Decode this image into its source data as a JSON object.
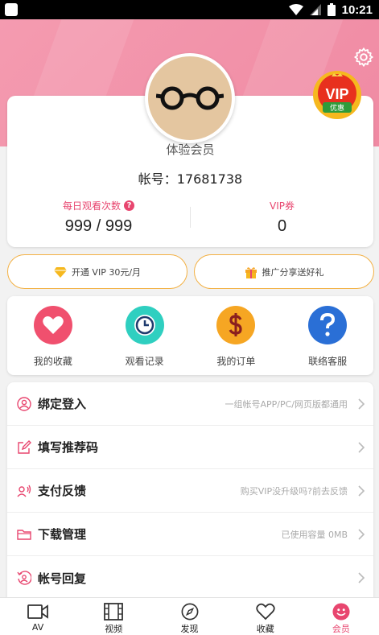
{
  "status_bar": {
    "time": "10:21"
  },
  "profile": {
    "member_name": "体验会员",
    "account": "帐号：17681738",
    "vip_badge_text": "VIP",
    "vip_badge_sub": "优惠",
    "stats": [
      {
        "label": "每日观看次数",
        "value": "999 / 999"
      },
      {
        "label": "VIP券",
        "value": "0"
      }
    ]
  },
  "pills": [
    {
      "label": "开通 VIP 30元/月",
      "icon": "diamond-icon"
    },
    {
      "label": "推广分享送好礼",
      "icon": "gift-icon"
    }
  ],
  "quick_actions": [
    {
      "label": "我的收藏",
      "icon": "heart-icon",
      "color": "#f0506e"
    },
    {
      "label": "观看记录",
      "icon": "clock-icon",
      "color": "#2fcfc0"
    },
    {
      "label": "我的订单",
      "icon": "dollar-icon",
      "color": "#f6a623"
    },
    {
      "label": "联络客服",
      "icon": "question-icon",
      "color": "#2a6fd6"
    }
  ],
  "menu": [
    {
      "title": "绑定登入",
      "hint": "一组帐号APP/PC/网页版都通用",
      "icon": "user-circle-icon"
    },
    {
      "title": "填写推荐码",
      "hint": "",
      "icon": "edit-icon"
    },
    {
      "title": "支付反馈",
      "hint": "购买VIP没升级吗?前去反馈",
      "icon": "feedback-icon"
    },
    {
      "title": "下载管理",
      "hint": "已使用容量 0MB",
      "icon": "folder-icon"
    },
    {
      "title": "帐号回复",
      "hint": "",
      "icon": "account-recover-icon"
    }
  ],
  "bottom_nav": [
    {
      "label": "AV",
      "icon": "camera-icon",
      "active": false
    },
    {
      "label": "视频",
      "icon": "film-icon",
      "active": false
    },
    {
      "label": "发现",
      "icon": "compass-icon",
      "active": false
    },
    {
      "label": "收藏",
      "icon": "heart-outline-icon",
      "active": false
    },
    {
      "label": "会员",
      "icon": "smile-icon",
      "active": true
    }
  ],
  "colors": {
    "accent": "#e8466f",
    "header": "#f49bb0",
    "pill_border": "#f3b144"
  }
}
